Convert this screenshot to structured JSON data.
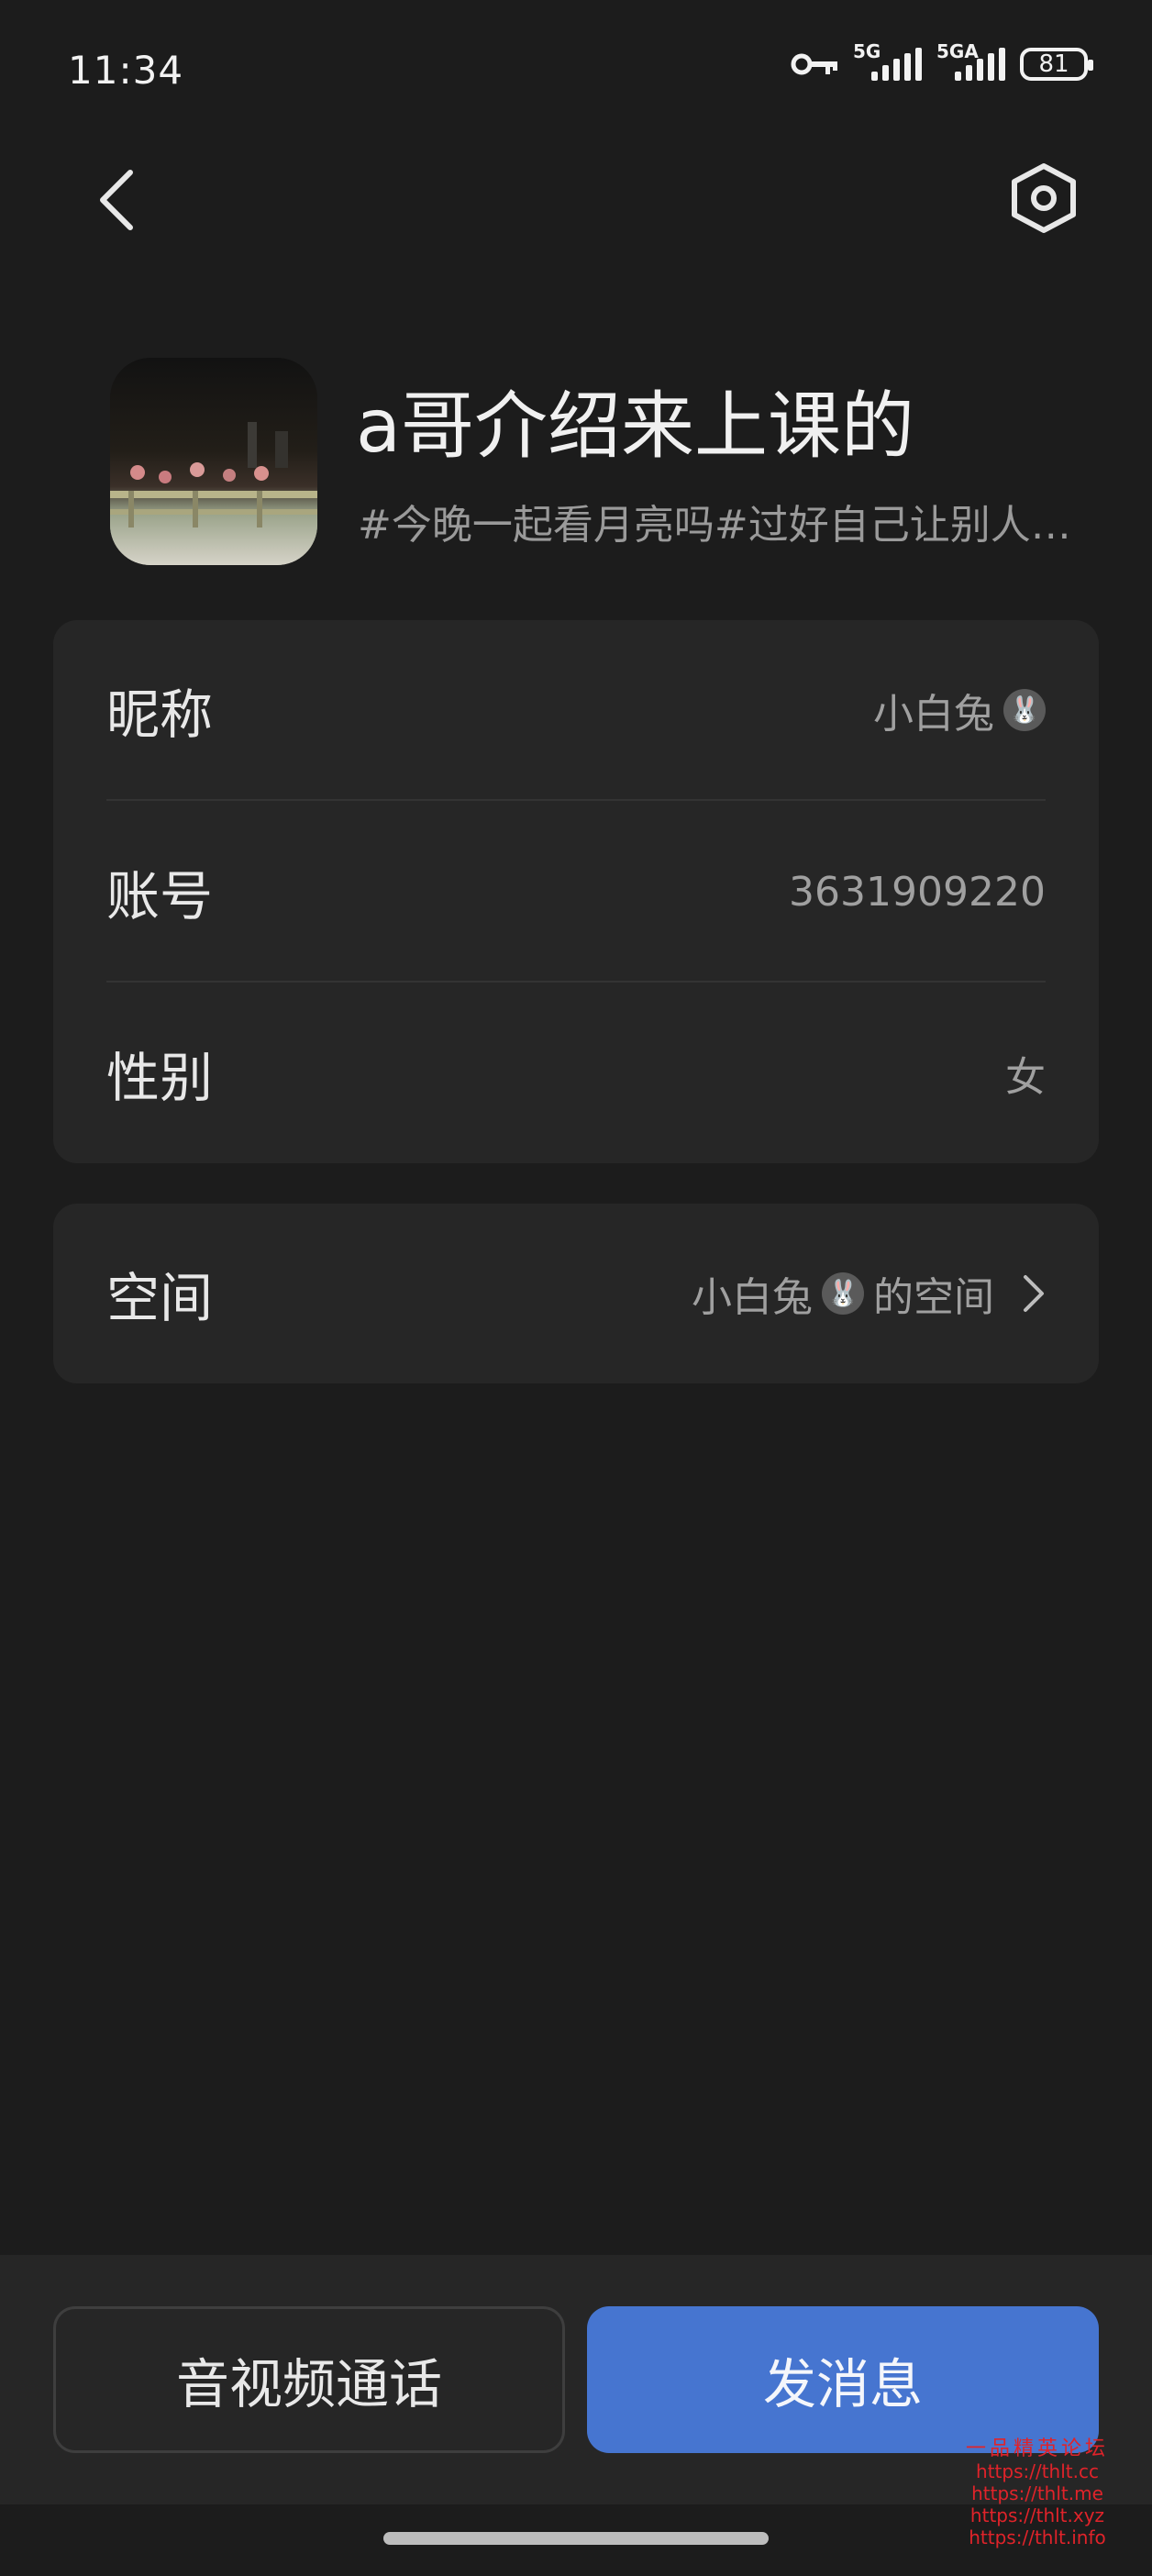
{
  "status_bar": {
    "time": "11:34",
    "network1": "5G",
    "network2": "5GA",
    "battery": "81"
  },
  "profile": {
    "name": "a哥介绍来上课的",
    "signature": "#今晚一起看月亮吗#过好自己让别人去说吧"
  },
  "info_rows": [
    {
      "label": "昵称",
      "value": "小白兔",
      "emoji": "rabbit-face"
    },
    {
      "label": "账号",
      "value": "3631909220"
    },
    {
      "label": "性别",
      "value": "女"
    }
  ],
  "space": {
    "label": "空间",
    "value_prefix": "小白兔",
    "value_suffix": "的空间"
  },
  "actions": {
    "call_label": "音视频通话",
    "message_label": "发消息"
  },
  "watermark": {
    "title": "一品精英论坛",
    "links": [
      "https://thlt.cc",
      "https://thlt.me",
      "https://thlt.xyz",
      "https://thlt.info"
    ]
  },
  "colors": {
    "background": "#1c1c1c",
    "card": "#262626",
    "primary": "#4675d0",
    "watermark": "#e0232a"
  }
}
